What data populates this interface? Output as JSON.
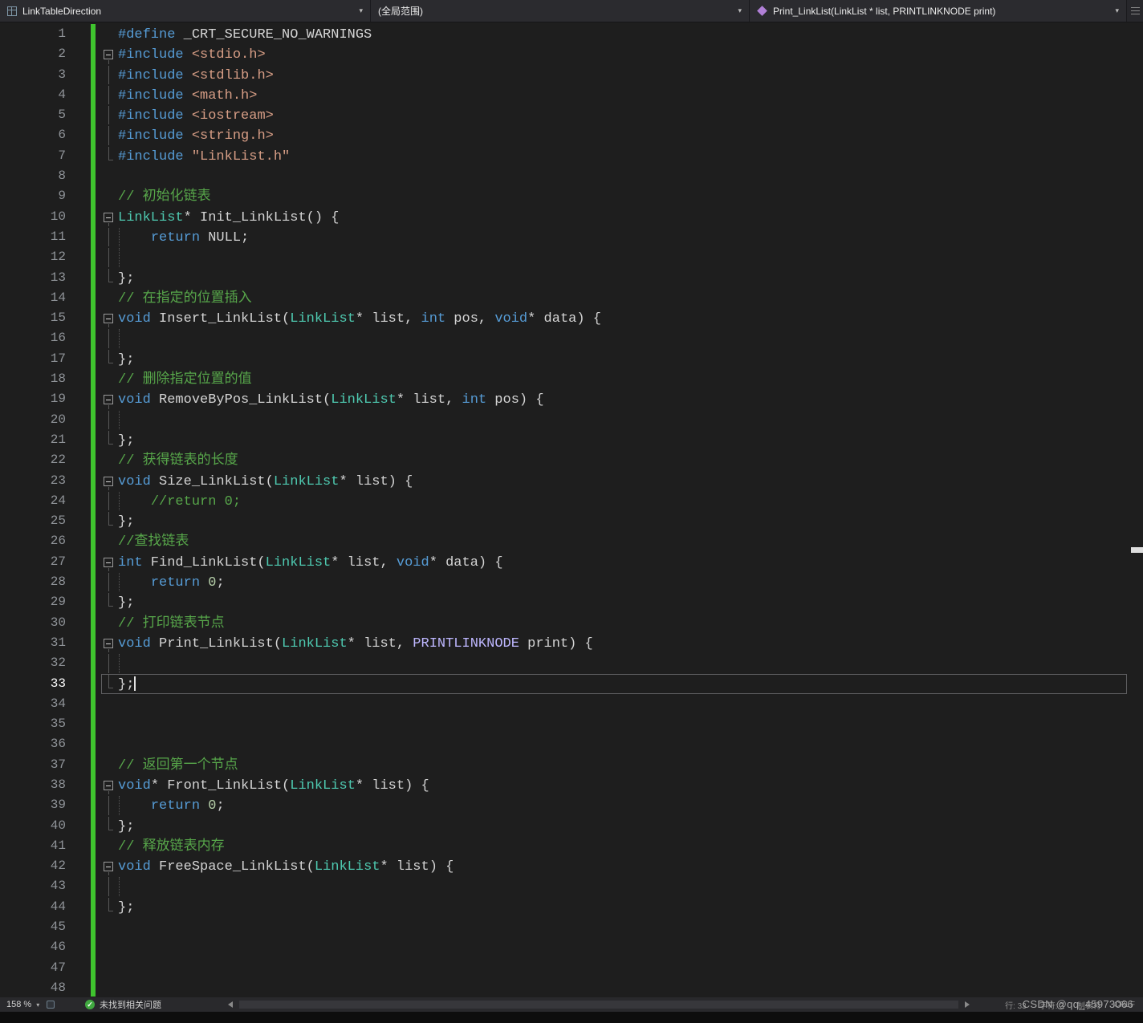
{
  "nav": {
    "context": "LinkTableDirection",
    "scope": "(全局范围)",
    "member": "Print_LinkList(LinkList * list, PRINTLINKNODE print)"
  },
  "icons": {
    "caret": "▾",
    "check": "✓"
  },
  "colors": {
    "background": "#1e1e1e",
    "keyword": "#569cd6",
    "type": "#4ec9b0",
    "string": "#d69d85",
    "comment": "#57a64a",
    "number": "#b5cea8",
    "macro": "#beb7ff",
    "default_text": "#d4d4d4",
    "change_bar_green": "#3fc42e",
    "check_green": "#40a940"
  },
  "status": {
    "zoom": "158 %",
    "message": "未找到相关问题",
    "line": "行: 33",
    "character": "字符: 3",
    "tabs": "制表符",
    "eol": "CRLF",
    "watermark": "CSDN @qq_45973066"
  },
  "editor": {
    "current_line": 33,
    "lines": [
      {
        "n": 1,
        "tokens": [
          [
            "k",
            "#define"
          ],
          [
            "d",
            " _CRT_SECURE_NO_WARNINGS"
          ]
        ]
      },
      {
        "n": 2,
        "m": "b",
        "tokens": [
          [
            "k",
            "#include"
          ],
          [
            "d",
            " "
          ],
          [
            "s",
            "<stdio.h>"
          ]
        ]
      },
      {
        "n": 3,
        "m": "l",
        "tokens": [
          [
            "k",
            "#include"
          ],
          [
            "d",
            " "
          ],
          [
            "s",
            "<stdlib.h>"
          ]
        ]
      },
      {
        "n": 4,
        "m": "l",
        "tokens": [
          [
            "k",
            "#include"
          ],
          [
            "d",
            " "
          ],
          [
            "s",
            "<math.h>"
          ]
        ]
      },
      {
        "n": 5,
        "m": "l",
        "tokens": [
          [
            "k",
            "#include"
          ],
          [
            "d",
            " "
          ],
          [
            "s",
            "<iostream>"
          ]
        ]
      },
      {
        "n": 6,
        "m": "l",
        "tokens": [
          [
            "k",
            "#include"
          ],
          [
            "d",
            " "
          ],
          [
            "s",
            "<string.h>"
          ]
        ]
      },
      {
        "n": 7,
        "m": "e",
        "tokens": [
          [
            "k",
            "#include"
          ],
          [
            "d",
            " "
          ],
          [
            "s",
            "\"LinkList.h\""
          ]
        ]
      },
      {
        "n": 8,
        "tokens": []
      },
      {
        "n": 9,
        "tokens": [
          [
            "c",
            "// 初始化链表"
          ]
        ]
      },
      {
        "n": 10,
        "m": "b",
        "tokens": [
          [
            "t",
            "LinkList"
          ],
          [
            "d",
            "* Init_LinkList() {"
          ]
        ]
      },
      {
        "n": 11,
        "m": "l",
        "g": true,
        "tokens": [
          [
            "d",
            "    "
          ],
          [
            "k",
            "return"
          ],
          [
            "d",
            " NULL;"
          ]
        ]
      },
      {
        "n": 12,
        "m": "l",
        "g": true,
        "tokens": []
      },
      {
        "n": 13,
        "m": "e",
        "tokens": [
          [
            "d",
            "};"
          ]
        ]
      },
      {
        "n": 14,
        "tokens": [
          [
            "c",
            "// 在指定的位置插入"
          ]
        ]
      },
      {
        "n": 15,
        "m": "b",
        "tokens": [
          [
            "k",
            "void"
          ],
          [
            "d",
            " Insert_LinkList("
          ],
          [
            "t",
            "LinkList"
          ],
          [
            "d",
            "* list, "
          ],
          [
            "k",
            "int"
          ],
          [
            "d",
            " pos, "
          ],
          [
            "k",
            "void"
          ],
          [
            "d",
            "* data) {"
          ]
        ]
      },
      {
        "n": 16,
        "m": "l",
        "g": true,
        "tokens": []
      },
      {
        "n": 17,
        "m": "e",
        "tokens": [
          [
            "d",
            "};"
          ]
        ]
      },
      {
        "n": 18,
        "tokens": [
          [
            "c",
            "// 删除指定位置的值"
          ]
        ]
      },
      {
        "n": 19,
        "m": "b",
        "tokens": [
          [
            "k",
            "void"
          ],
          [
            "d",
            " RemoveByPos_LinkList("
          ],
          [
            "t",
            "LinkList"
          ],
          [
            "d",
            "* list, "
          ],
          [
            "k",
            "int"
          ],
          [
            "d",
            " pos) {"
          ]
        ]
      },
      {
        "n": 20,
        "m": "l",
        "g": true,
        "tokens": []
      },
      {
        "n": 21,
        "m": "e",
        "tokens": [
          [
            "d",
            "};"
          ]
        ]
      },
      {
        "n": 22,
        "tokens": [
          [
            "c",
            "// 获得链表的长度"
          ]
        ]
      },
      {
        "n": 23,
        "m": "b",
        "tokens": [
          [
            "k",
            "void"
          ],
          [
            "d",
            " Size_LinkList("
          ],
          [
            "t",
            "LinkList"
          ],
          [
            "d",
            "* list) {"
          ]
        ]
      },
      {
        "n": 24,
        "m": "l",
        "g": true,
        "tokens": [
          [
            "d",
            "    "
          ],
          [
            "c",
            "//return 0;"
          ]
        ]
      },
      {
        "n": 25,
        "m": "e",
        "tokens": [
          [
            "d",
            "};"
          ]
        ]
      },
      {
        "n": 26,
        "tokens": [
          [
            "c",
            "//查找链表"
          ]
        ]
      },
      {
        "n": 27,
        "m": "b",
        "tokens": [
          [
            "k",
            "int"
          ],
          [
            "d",
            " Find_LinkList("
          ],
          [
            "t",
            "LinkList"
          ],
          [
            "d",
            "* list, "
          ],
          [
            "k",
            "void"
          ],
          [
            "d",
            "* data) {"
          ]
        ]
      },
      {
        "n": 28,
        "m": "l",
        "g": true,
        "tokens": [
          [
            "d",
            "    "
          ],
          [
            "k",
            "return"
          ],
          [
            "d",
            " "
          ],
          [
            "n",
            "0"
          ],
          [
            "d",
            ";"
          ]
        ]
      },
      {
        "n": 29,
        "m": "e",
        "tokens": [
          [
            "d",
            "};"
          ]
        ]
      },
      {
        "n": 30,
        "tokens": [
          [
            "c",
            "// 打印链表节点"
          ]
        ]
      },
      {
        "n": 31,
        "m": "b",
        "tokens": [
          [
            "k",
            "void"
          ],
          [
            "d",
            " Print_LinkList("
          ],
          [
            "t",
            "LinkList"
          ],
          [
            "d",
            "* list, "
          ],
          [
            "m",
            "PRINTLINKNODE"
          ],
          [
            "d",
            " print) {"
          ]
        ]
      },
      {
        "n": 32,
        "m": "l",
        "g": true,
        "tokens": []
      },
      {
        "n": 33,
        "m": "e",
        "tokens": [
          [
            "d",
            "};"
          ]
        ]
      },
      {
        "n": 34,
        "tokens": []
      },
      {
        "n": 35,
        "tokens": []
      },
      {
        "n": 36,
        "tokens": []
      },
      {
        "n": 37,
        "tokens": [
          [
            "c",
            "// 返回第一个节点"
          ]
        ]
      },
      {
        "n": 38,
        "m": "b",
        "tokens": [
          [
            "k",
            "void"
          ],
          [
            "d",
            "* Front_LinkList("
          ],
          [
            "t",
            "LinkList"
          ],
          [
            "d",
            "* list) {"
          ]
        ]
      },
      {
        "n": 39,
        "m": "l",
        "g": true,
        "tokens": [
          [
            "d",
            "    "
          ],
          [
            "k",
            "return"
          ],
          [
            "d",
            " "
          ],
          [
            "n",
            "0"
          ],
          [
            "d",
            ";"
          ]
        ]
      },
      {
        "n": 40,
        "m": "e",
        "tokens": [
          [
            "d",
            "};"
          ]
        ]
      },
      {
        "n": 41,
        "tokens": [
          [
            "c",
            "// 释放链表内存"
          ]
        ]
      },
      {
        "n": 42,
        "m": "b",
        "tokens": [
          [
            "k",
            "void"
          ],
          [
            "d",
            " FreeSpace_LinkList("
          ],
          [
            "t",
            "LinkList"
          ],
          [
            "d",
            "* list) {"
          ]
        ]
      },
      {
        "n": 43,
        "m": "l",
        "g": true,
        "tokens": []
      },
      {
        "n": 44,
        "m": "e",
        "tokens": [
          [
            "d",
            "};"
          ]
        ]
      },
      {
        "n": 45,
        "tokens": []
      },
      {
        "n": 46,
        "tokens": []
      },
      {
        "n": 47,
        "tokens": []
      },
      {
        "n": 48,
        "tokens": []
      }
    ]
  }
}
